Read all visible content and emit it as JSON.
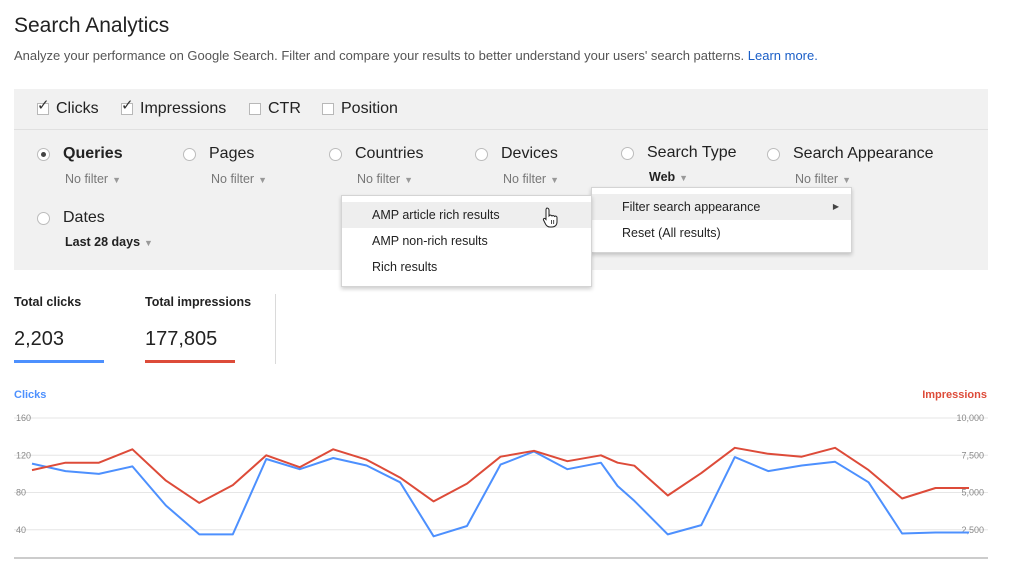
{
  "header": {
    "title": "Search Analytics",
    "description": "Analyze your performance on Google Search. Filter and compare your results to better understand your users' search patterns.",
    "learn_more": "Learn more."
  },
  "metrics": [
    {
      "label": "Clicks",
      "checked": true
    },
    {
      "label": "Impressions",
      "checked": true
    },
    {
      "label": "CTR",
      "checked": false
    },
    {
      "label": "Position",
      "checked": false
    }
  ],
  "dimensions": {
    "queries": {
      "label": "Queries",
      "filter": "No filter",
      "selected": true
    },
    "pages": {
      "label": "Pages",
      "filter": "No filter"
    },
    "countries": {
      "label": "Countries",
      "filter": "No filter"
    },
    "devices": {
      "label": "Devices",
      "filter": "No filter"
    },
    "search_type": {
      "label": "Search Type",
      "filter": "Web"
    },
    "search_appearance": {
      "label": "Search Appearance",
      "filter": "No filter"
    },
    "dates": {
      "label": "Dates",
      "filter": "Last 28 days"
    }
  },
  "appearance_submenu": {
    "items": [
      "AMP article rich results",
      "AMP non-rich results",
      "Rich results"
    ]
  },
  "appearance_menu": {
    "items": [
      "Filter search appearance",
      "Reset (All results)"
    ]
  },
  "totals": {
    "clicks": {
      "label": "Total clicks",
      "value": "2,203",
      "color": "#4d90fe"
    },
    "impressions": {
      "label": "Total impressions",
      "value": "177,805",
      "color": "#dd4b39"
    }
  },
  "chart_data": {
    "type": "line",
    "left_axis": {
      "title": "Clicks",
      "ticks": [
        "160",
        "120",
        "80",
        "40"
      ],
      "range": [
        0,
        160
      ],
      "color": "#4d90fe"
    },
    "right_axis": {
      "title": "Impressions",
      "ticks": [
        "10,000",
        "7,500",
        "5,000",
        "2,500"
      ],
      "range": [
        0,
        10000
      ],
      "color": "#dd4b39"
    },
    "grid": true,
    "x": [
      1,
      2,
      3,
      4,
      5,
      6,
      7,
      8,
      9,
      10,
      11,
      12,
      13,
      14,
      15,
      16,
      17,
      18,
      18.5,
      19,
      20,
      21,
      22,
      23,
      24,
      25,
      26,
      27,
      28,
      29
    ],
    "series": [
      {
        "name": "Clicks",
        "axis": "left",
        "color": "#4d90fe",
        "values": [
          111,
          103,
          100,
          108,
          66,
          35,
          35,
          116,
          105,
          117,
          109,
          91,
          33,
          44,
          110,
          124,
          105,
          112,
          87,
          71,
          35,
          45,
          118,
          103,
          109,
          113,
          91,
          36,
          37,
          37
        ]
      },
      {
        "name": "Impressions",
        "axis": "right",
        "color": "#dd4b39",
        "values": [
          6500,
          7000,
          7000,
          7900,
          5800,
          4300,
          5500,
          7500,
          6700,
          7900,
          7200,
          6000,
          4400,
          5600,
          7400,
          7800,
          7100,
          7500,
          7000,
          6800,
          4800,
          6300,
          8000,
          7600,
          7400,
          8000,
          6500,
          4600,
          5300,
          5300
        ]
      }
    ]
  }
}
